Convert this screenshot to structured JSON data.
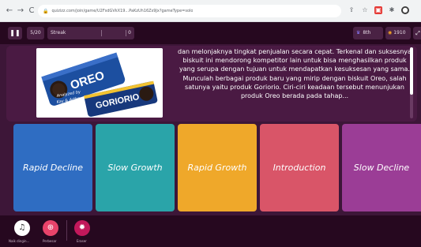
{
  "browser": {
    "back": "←",
    "forward": "→",
    "reload": "C",
    "lock": "🔒",
    "url": "quizizz.com/join/game/U2FsdGVkX19...PaKzUh16Zs9Jx?gameType=solo",
    "icons": [
      "share-icon",
      "star-icon",
      "extension-icon",
      "puzzle-icon",
      "profile-icon"
    ],
    "share_glyph": "⇪",
    "star_glyph": "☆",
    "ext_glyph": "▣",
    "puzzle_glyph": "✱",
    "profile_glyph": "●"
  },
  "topbar": {
    "pause_glyph": "❚❚",
    "question_counter": "5/20",
    "streak_label": "Streak",
    "streak_value": "0",
    "rank_glyph": "♛",
    "rank": "8th",
    "score_glyph": "◉",
    "score": "1910",
    "expand_glyph": "⤢"
  },
  "question": {
    "image_alt": "OREO vs GORIORIO — Analyzed by Kay & Artha",
    "brand_1": "OREO",
    "brand_2": "GORIORIO",
    "caption_line1": "Analyzed by",
    "caption_line2": "Kay & Artha",
    "text": "dan melonjaknya tingkat penjualan secara cepat. Terkenal dan suksesnya biskuit ini mendorong kompetitor lain untuk bisa menghasilkan produk yang serupa dengan tujuan untuk mendapatkan kesuksesan yang sama. Munculah berbagai produk baru yang mirip dengan biskuit Oreo, salah satunya yaitu produk Goriorio. Ciri-ciri keadaan tersebut menunjukan produk Oreo berada pada tahap..."
  },
  "options": [
    {
      "label": "Rapid Decline",
      "color": "#2f6dc2"
    },
    {
      "label": "Slow Growth",
      "color": "#2aa4a9"
    },
    {
      "label": "Rapid Growth",
      "color": "#efa82a"
    },
    {
      "label": "Introduction",
      "color": "#d95568"
    },
    {
      "label": "Slow Decline",
      "color": "#9b3d96"
    }
  ],
  "powerups": {
    "music_glyph": "♫",
    "music_label": "Naik dingin...",
    "zoom_glyph": "⊕",
    "zoom_label": "Perbesar",
    "boom_glyph": "✹",
    "boom_label": "Eraser"
  }
}
